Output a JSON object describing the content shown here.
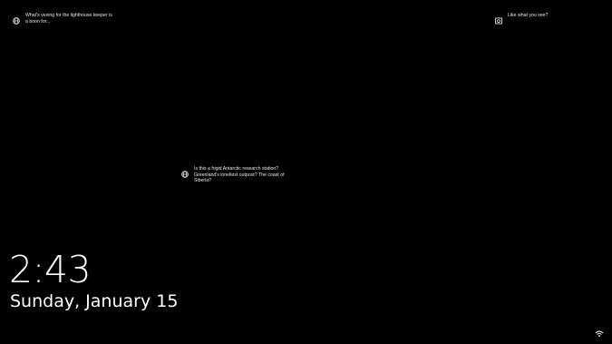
{
  "lockscreen": {
    "hotspots": [
      {
        "icon": "globe-icon",
        "text": "What's vexing for the lighthouse keeper is a boon for..."
      },
      {
        "icon": "camera-icon",
        "text": "Like what you see?"
      },
      {
        "icon": "globe-icon",
        "text": "Is this a frigid Antarctic research station? Greenland's loneliest outpost? The coast of Siberia?"
      }
    ],
    "time": "2:43",
    "date": "Sunday, January 15",
    "status_icon": "network-icon"
  }
}
